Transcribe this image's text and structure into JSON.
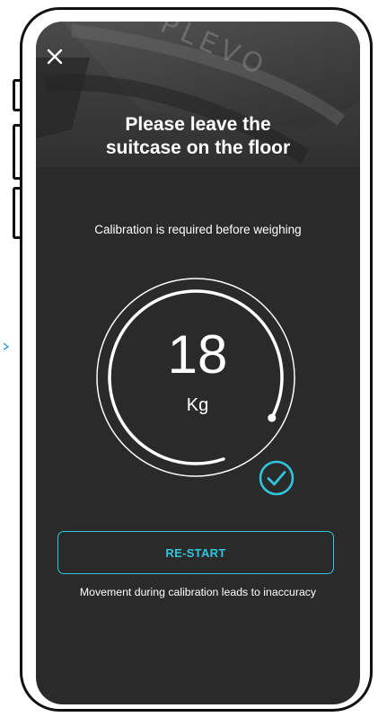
{
  "header": {
    "title_line1": "Please leave the",
    "title_line2": "suitcase on the floor",
    "photo_engraving": "PLEVO",
    "close_icon": "close-icon"
  },
  "calibration": {
    "instruction": "Calibration is required before  weighing",
    "weight_value": "18",
    "weight_unit": "Kg",
    "progress_fraction": 0.88,
    "status_icon": "check-circle-icon"
  },
  "actions": {
    "restart_label": "RE-START"
  },
  "footer": {
    "warning": "Movement during calibration leads to inaccuracy"
  },
  "colors": {
    "background": "#2a2a2a",
    "accent": "#30c5dd",
    "text": "#ffffff"
  }
}
